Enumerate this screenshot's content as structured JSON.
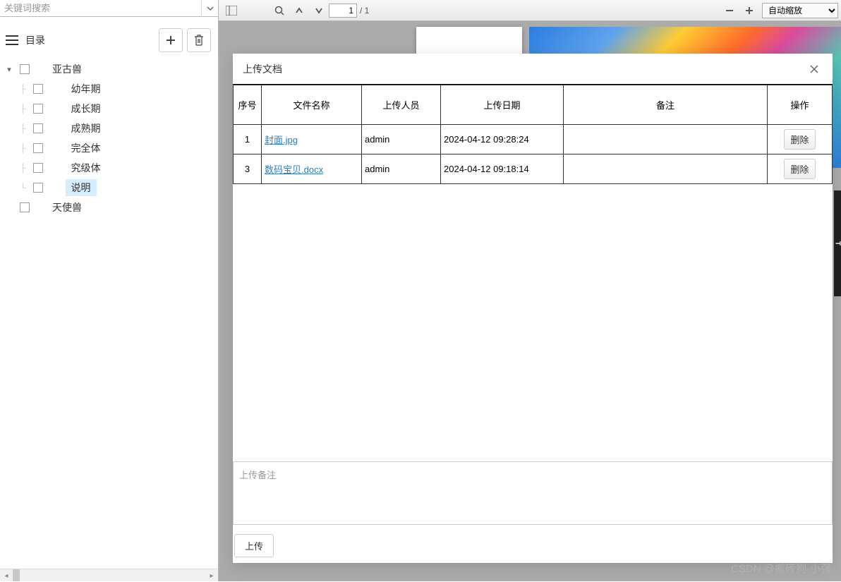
{
  "sidebar": {
    "search_placeholder": "关键词搜索",
    "catalog_title": "目录",
    "tree": [
      {
        "label": "亚古兽",
        "level": 0,
        "expanded": true,
        "selected": false,
        "children": [
          {
            "label": "幼年期",
            "level": 1,
            "selected": false
          },
          {
            "label": "成长期",
            "level": 1,
            "selected": false
          },
          {
            "label": "成熟期",
            "level": 1,
            "selected": false
          },
          {
            "label": "完全体",
            "level": 1,
            "selected": false
          },
          {
            "label": "究级体",
            "level": 1,
            "selected": false
          },
          {
            "label": "说明",
            "level": 1,
            "selected": true
          }
        ]
      },
      {
        "label": "天使兽",
        "level": 0,
        "expanded": false,
        "selected": false,
        "children": []
      }
    ]
  },
  "toolbar": {
    "page_current": "1",
    "page_total": "/ 1",
    "zoom_label": "自动缩放"
  },
  "modal": {
    "title": "上传文档",
    "columns": {
      "seq": "序号",
      "name": "文件名称",
      "user": "上传人员",
      "date": "上传日期",
      "note": "备注",
      "op": "操作"
    },
    "rows": [
      {
        "seq": "1",
        "name": "封面.jpg",
        "user": "admin",
        "date": "2024-04-12 09:28:24",
        "note": "",
        "op": "删除"
      },
      {
        "seq": "3",
        "name": "数码宝贝.docx",
        "user": "admin",
        "date": "2024-04-12 09:18:14",
        "note": "",
        "op": "删除"
      }
    ],
    "note_placeholder": "上传备注",
    "upload_label": "上传"
  },
  "watermark": "CSDN @搬砖狗-小强"
}
